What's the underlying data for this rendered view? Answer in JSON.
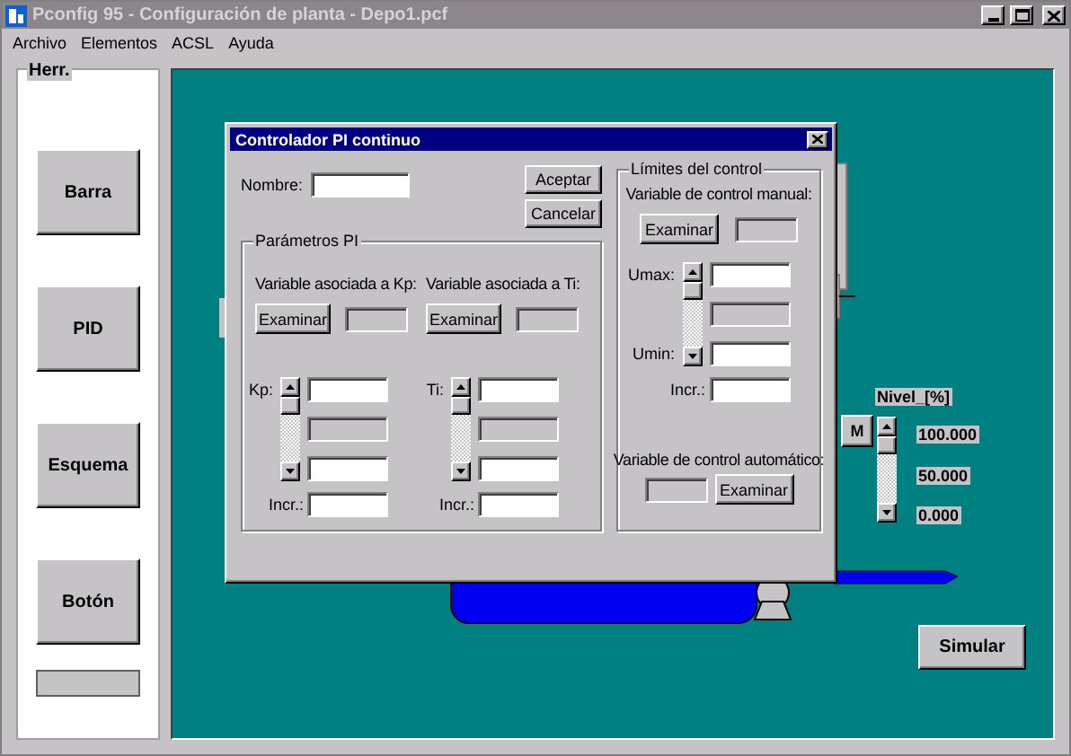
{
  "window": {
    "title": "Pconfig 95 - Configuración de planta - Depo1.pcf"
  },
  "menu": [
    "Archivo",
    "Elementos",
    "ACSL",
    "Ayuda"
  ],
  "toolbox": {
    "title": "Herr.",
    "buttons": [
      "Barra",
      "PID",
      "Esquema",
      "Botón"
    ]
  },
  "canvas": {
    "mode_button": "M",
    "level_meter": {
      "title": "Nivel_[%]",
      "scale": [
        "100.000",
        "50.000",
        "0.000"
      ]
    },
    "simulate_button": "Simular"
  },
  "dialog": {
    "title": "Controlador PI continuo",
    "name_label": "Nombre:",
    "buttons": [
      "Aceptar",
      "Cancelar"
    ],
    "pi_group": {
      "title": "Parámetros PI",
      "columns": [
        {
          "caption": "Variable asociada a Kp:",
          "button": "Examinar",
          "fields": [
            {
              "label": "Kp:",
              "disabled": false
            },
            {
              "disabled": true
            },
            {
              "disabled": false
            }
          ],
          "incr_label": "Incr.:"
        },
        {
          "caption": "Variable asociada a Ti:",
          "button": "Examinar",
          "fields": [
            {
              "label": "Ti:",
              "disabled": false
            },
            {
              "disabled": true
            },
            {
              "disabled": false
            }
          ],
          "incr_label": "Incr.:"
        }
      ]
    },
    "limits_group": {
      "title": "Límites del control",
      "manual": {
        "caption": "Variable de control manual:",
        "button": "Examinar"
      },
      "fields": [
        {
          "label": "Umax:",
          "disabled": false
        },
        {
          "disabled": true
        },
        {
          "label": "Umin:",
          "disabled": false
        }
      ],
      "incr_label": "Incr.:",
      "automatic": {
        "caption": "Variable de control automático:",
        "button": "Examinar"
      }
    }
  }
}
